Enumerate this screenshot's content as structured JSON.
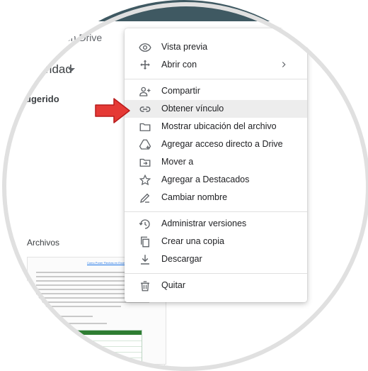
{
  "tab": {
    "label": "en Drive"
  },
  "left": {
    "priority_label": "ridad",
    "suggested_label": "ugerido",
    "files_label": "Archivos",
    "doc_preview": {
      "title": "Como Poner Flechas en Excel",
      "table_header_color": "#2e7d32"
    }
  },
  "context_menu": {
    "items": [
      {
        "id": "preview",
        "label": "Vista previa",
        "icon": "eye-icon"
      },
      {
        "id": "open-with",
        "label": "Abrir con",
        "icon": "move-arrows-icon",
        "has_submenu": true
      },
      {
        "id": "share",
        "label": "Compartir",
        "icon": "person-add-icon"
      },
      {
        "id": "get-link",
        "label": "Obtener vínculo",
        "icon": "link-icon",
        "highlighted": true
      },
      {
        "id": "show-location",
        "label": "Mostrar ubicación del archivo",
        "icon": "folder-icon"
      },
      {
        "id": "add-shortcut",
        "label": "Agregar acceso directo a Drive",
        "icon": "drive-shortcut-icon"
      },
      {
        "id": "move-to",
        "label": "Mover a",
        "icon": "folder-move-icon"
      },
      {
        "id": "add-starred",
        "label": "Agregar a Destacados",
        "icon": "star-icon"
      },
      {
        "id": "rename",
        "label": "Cambiar nombre",
        "icon": "pencil-icon"
      },
      {
        "id": "manage-versions",
        "label": "Administrar versiones",
        "icon": "history-icon"
      },
      {
        "id": "make-copy",
        "label": "Crear una copia",
        "icon": "copy-icon"
      },
      {
        "id": "download",
        "label": "Descargar",
        "icon": "download-icon"
      },
      {
        "id": "remove",
        "label": "Quitar",
        "icon": "trash-icon"
      }
    ]
  },
  "colors": {
    "topbar": "#3f5962",
    "highlight": "#ededed",
    "annotation_arrow": "#e53935",
    "icon": "#5f6368",
    "text": "#202124"
  }
}
